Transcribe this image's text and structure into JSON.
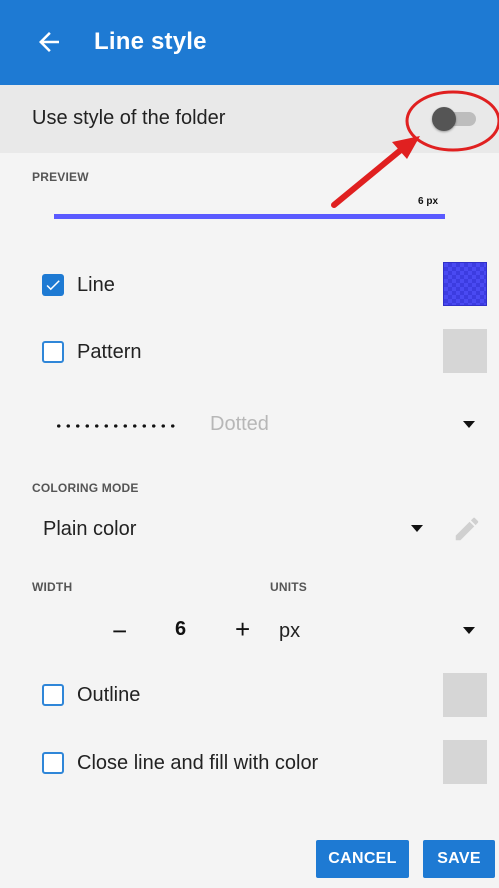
{
  "header": {
    "title": "Line style",
    "back_icon": "arrow-left-icon"
  },
  "folder_style": {
    "label": "Use style of the folder",
    "enabled": false
  },
  "preview": {
    "section_label": "PREVIEW",
    "size_label": "6 px",
    "line_color": "#5a5aff"
  },
  "line": {
    "label": "Line",
    "checked": true,
    "color": "#4a4af2"
  },
  "pattern": {
    "label": "Pattern",
    "checked": false
  },
  "pattern_style": {
    "selected": "Dotted"
  },
  "coloring_mode": {
    "section_label": "COLORING MODE",
    "selected": "Plain color"
  },
  "width": {
    "section_label": "WIDTH",
    "minus": "−",
    "value": "6",
    "plus": "+"
  },
  "units": {
    "section_label": "UNITS",
    "selected": "px"
  },
  "outline": {
    "label": "Outline",
    "checked": false
  },
  "close_fill": {
    "label": "Close line and fill with color",
    "checked": false
  },
  "actions": {
    "cancel": "CANCEL",
    "save": "SAVE"
  },
  "colors": {
    "accent": "#1e7ad3",
    "annotation": "#e02020"
  }
}
